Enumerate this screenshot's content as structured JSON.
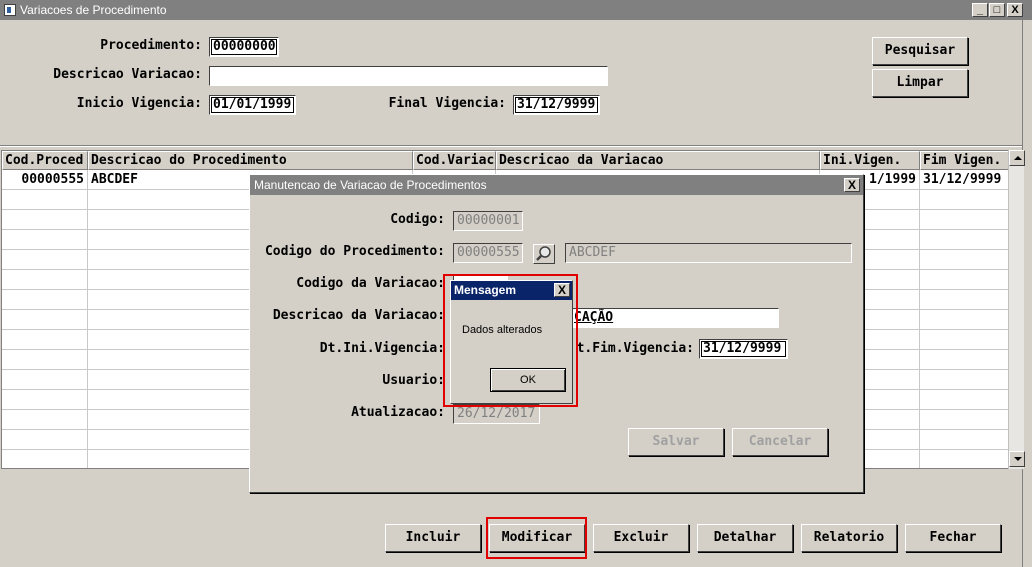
{
  "window": {
    "title": "Variacoes de Procedimento",
    "buttons": [
      "_",
      "□",
      "X"
    ]
  },
  "search": {
    "procedimento_label": "Procedimento:",
    "procedimento_value": "00000000",
    "descricao_label": "Descricao Variacao:",
    "descricao_value": "",
    "inicio_label": "Inicio Vigencia:",
    "inicio_value": "01/01/1999",
    "final_label": "Final Vigencia:",
    "final_value": "31/12/9999",
    "pesquisar_label": "Pesquisar",
    "limpar_label": "Limpar"
  },
  "grid": {
    "columns": [
      "Cod.Proced",
      "Descricao do Procedimento",
      "Cod.Variac",
      "Descricao da Variacao",
      "Ini.Vigen.",
      "Fim Vigen."
    ],
    "rows": [
      [
        "00000555",
        "ABCDEF",
        "",
        "",
        "1/1999",
        "31/12/9999"
      ]
    ]
  },
  "dialog": {
    "title": "Manutencao de Variacao de Procedimentos",
    "close": "X",
    "codigo_label": "Codigo:",
    "codigo_value": "00000001",
    "cod_proc_label": "Codigo do Procedimento:",
    "cod_proc_value": "00000555",
    "proc_desc_value": "ABCDEF",
    "cod_var_label": "Codigo da Variacao:",
    "desc_var_label": "Descricao da Variacao:",
    "desc_var_value": "CAÇÃO",
    "dt_ini_label": "Dt.Ini.Vigencia:",
    "dt_fim_label": "t.Fim.Vigencia:",
    "dt_fim_value": "31/12/9999",
    "usuario_label": "Usuario:",
    "atualizacao_label": "Atualizacao:",
    "atualizacao_value": "26/12/2017",
    "salvar_label": "Salvar",
    "cancelar_label": "Cancelar"
  },
  "message": {
    "title": "Mensagem",
    "close": "X",
    "text": "Dados alterados",
    "ok_label": "OK"
  },
  "footer": {
    "incluir_label": "Incluir",
    "modificar_label": "Modificar",
    "excluir_label": "Excluir",
    "detalhar_label": "Detalhar",
    "relatorio_label": "Relatorio",
    "fechar_label": "Fechar"
  },
  "highlight_color": "#e00000",
  "title_active_color": "#0a246a",
  "title_inactive_color": "#808080"
}
